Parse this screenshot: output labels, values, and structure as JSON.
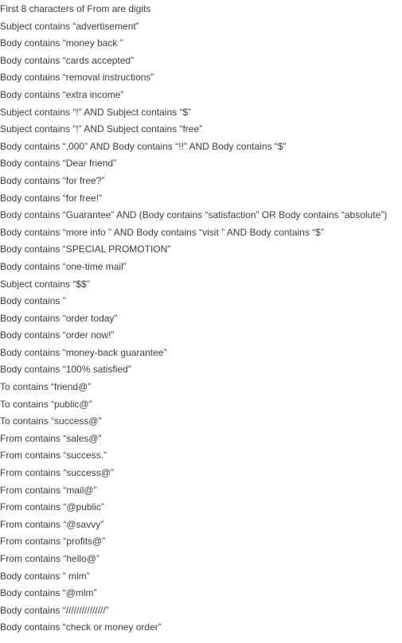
{
  "rules": [
    "First 8 characters of From are digits",
    "Subject contains “advertisement”",
    "Body contains “money back ”",
    "Body contains “cards accepted”",
    "Body contains “removal instructions”",
    "Body contains “extra income”",
    "Subject contains “!” AND Subject contains “$”",
    "Subject contains “!” AND Subject contains “free”",
    "Body contains “,000” AND Body contains “!!” AND Body contains “$”",
    "Body contains “Dear friend”",
    "Body contains “for free?”",
    "Body contains “for free!”",
    "Body contains “Guarantee” AND (Body contains “satisfaction” OR Body contains “absolute”)",
    "Body contains “more info ” AND Body contains “visit ” AND Body contains “$”",
    "Body contains “SPECIAL PROMOTION”",
    "Body contains “one-time mail”",
    "Subject contains “$$”",
    "Body contains ”",
    "Body contains “order today”",
    "Body contains “order now!”",
    "Body contains “money-back guarantee”",
    "Body contains “100% satisfied”",
    "To contains “friend@”",
    "To contains “public@”",
    "To contains “success@”",
    "From contains “sales@”",
    "From contains “success.”",
    "From contains “success@”",
    "From contains “mail@”",
    "From contains “@public”",
    "From contains “@savvy”",
    "From contains “profits@”",
    "From contains “hello@”",
    "Body contains ” mlm”",
    "Body contains “@mlm”",
    "Body contains “///////////////”",
    "Body contains “check or money order”"
  ]
}
